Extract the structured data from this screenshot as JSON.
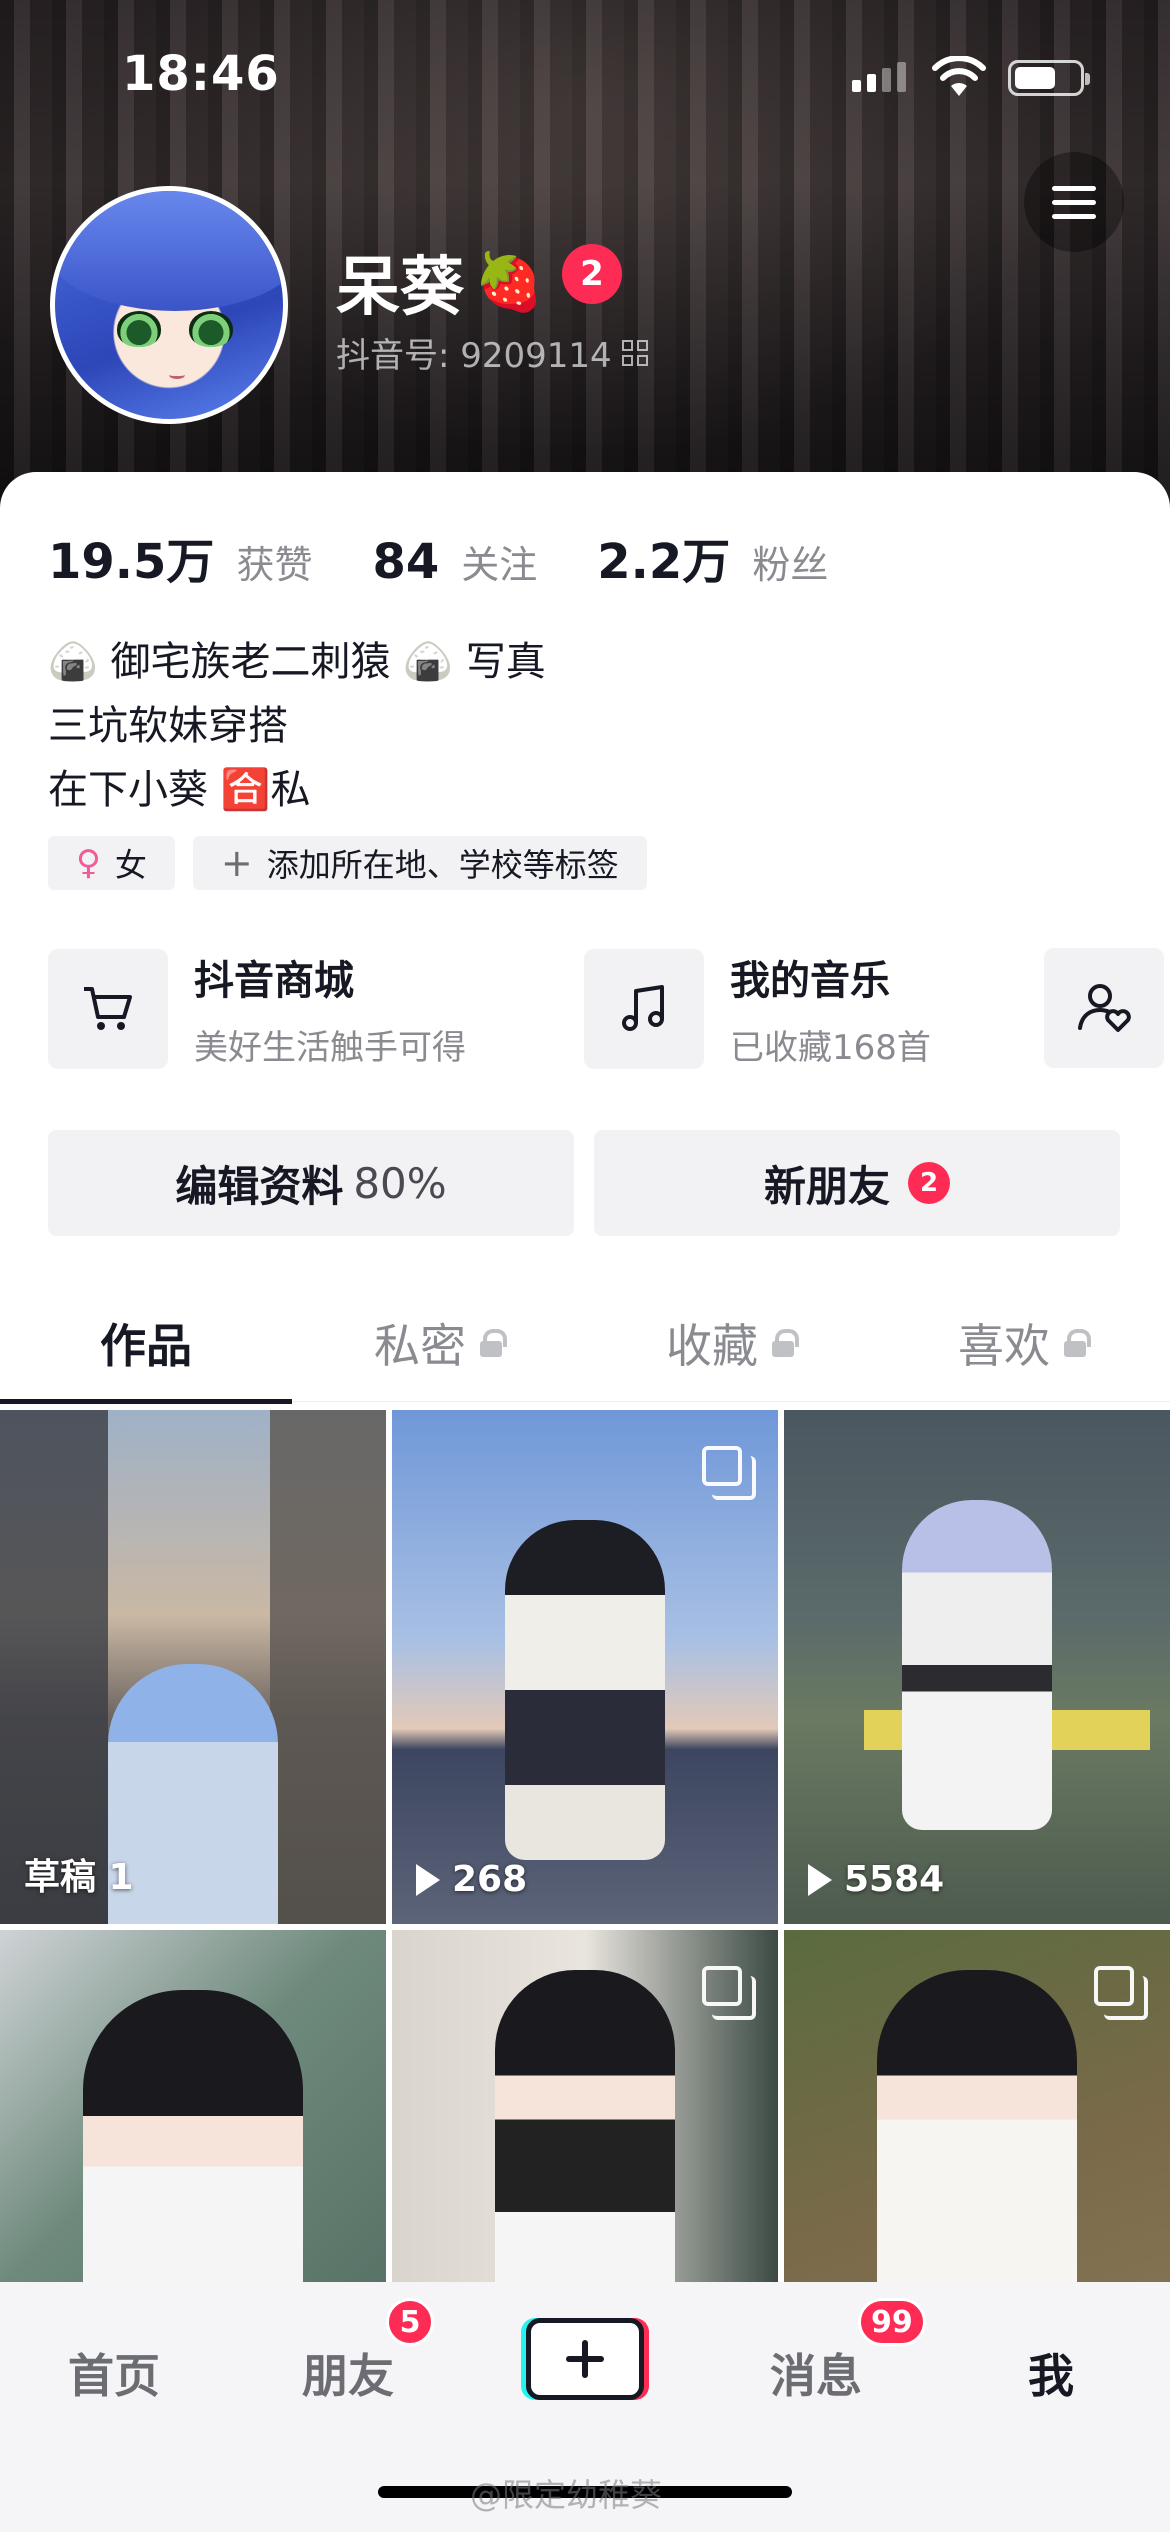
{
  "status_bar": {
    "time": "18:46"
  },
  "profile": {
    "name": "呆葵",
    "name_emoji": "🍓",
    "notification_count": "2",
    "douyin_id": "抖音号: 9209114"
  },
  "stats": [
    {
      "value": "19.5万",
      "label": "获赞"
    },
    {
      "value": "84",
      "label": "关注"
    },
    {
      "value": "2.2万",
      "label": "粉丝"
    }
  ],
  "bio": [
    "🍙 御宅族老二刺猿 🍙 写真",
    "三坑软妹穿搭",
    "在下小葵 🈴私"
  ],
  "tags": [
    {
      "icon": "female-icon",
      "label": "女"
    },
    {
      "icon": "plus-icon",
      "label": "添加所在地、学校等标签"
    }
  ],
  "services": [
    {
      "icon": "cart-icon",
      "title": "抖音商城",
      "subtitle": "美好生活触手可得"
    },
    {
      "icon": "music-note-icon",
      "title": "我的音乐",
      "subtitle": "已收藏168首"
    }
  ],
  "actions": {
    "edit_profile": "编辑资料",
    "edit_profile_percent": "80%",
    "new_friends": "新朋友",
    "new_friends_badge": "2"
  },
  "tabs": [
    {
      "label": "作品",
      "active": true,
      "locked": false
    },
    {
      "label": "私密",
      "active": false,
      "locked": true
    },
    {
      "label": "收藏",
      "active": false,
      "locked": true
    },
    {
      "label": "喜欢",
      "active": false,
      "locked": true
    }
  ],
  "videos": [
    {
      "label": "草稿 1",
      "type": "draft"
    },
    {
      "label": "268",
      "type": "plays",
      "multi": true
    },
    {
      "label": "5584",
      "type": "plays"
    },
    {
      "label": "",
      "type": "none"
    },
    {
      "label": "",
      "type": "none",
      "multi": true
    },
    {
      "label": "",
      "type": "none",
      "multi": true
    }
  ],
  "bottom_nav": {
    "home": "首页",
    "friends": "朋友",
    "friends_badge": "5",
    "messages": "消息",
    "messages_badge": "99",
    "me": "我"
  },
  "watermark": "@限定幼稚葵",
  "colors": {
    "accent": "#fe2c55",
    "cyan": "#25f4ee",
    "text": "#161823",
    "muted": "#8a8b91"
  }
}
